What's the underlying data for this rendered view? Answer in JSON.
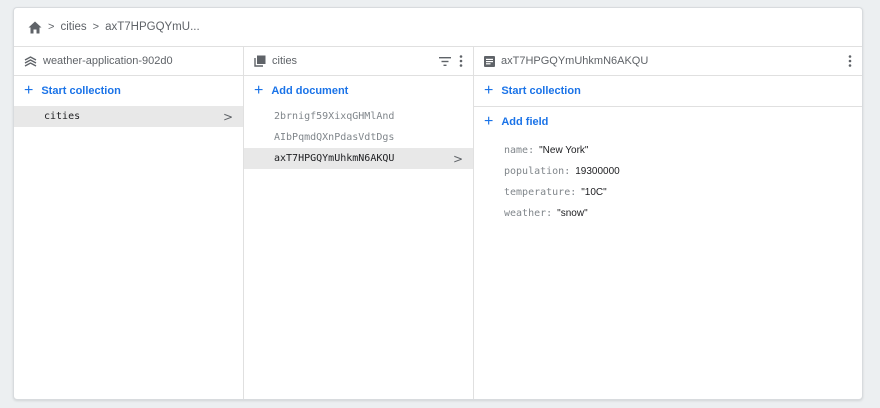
{
  "breadcrumb": {
    "home_icon": "home-icon",
    "items": [
      "cities",
      "axT7HPGQYmU..."
    ]
  },
  "pane_root": {
    "title": "weather-application-902d0",
    "icon": "firestore-icon",
    "start_collection_label": "Start collection",
    "items": [
      {
        "label": "cities",
        "selected": true
      }
    ]
  },
  "pane_collection": {
    "title": "cities",
    "icon": "collection-icon",
    "add_document_label": "Add document",
    "items": [
      {
        "label": "2brnigf59XixqGHMlAnd",
        "selected": false
      },
      {
        "label": "AIbPqmdQXnPdasVdtDgs",
        "selected": false
      },
      {
        "label": "axT7HPGQYmUhkmN6AKQU",
        "selected": true
      }
    ]
  },
  "pane_document": {
    "title": "axT7HPGQYmUhkmN6AKQU",
    "icon": "document-icon",
    "start_collection_label": "Start collection",
    "add_field_label": "Add field",
    "fields": [
      {
        "key": "name:",
        "value": "\"New York\""
      },
      {
        "key": "population:",
        "value": "19300000"
      },
      {
        "key": "temperature:",
        "value": "\"10C\""
      },
      {
        "key": "weather:",
        "value": "\"snow\""
      }
    ]
  },
  "colors": {
    "accent": "#1a73e8",
    "selected_bg": "#e8e8e8",
    "page_bg": "#eceff1"
  }
}
